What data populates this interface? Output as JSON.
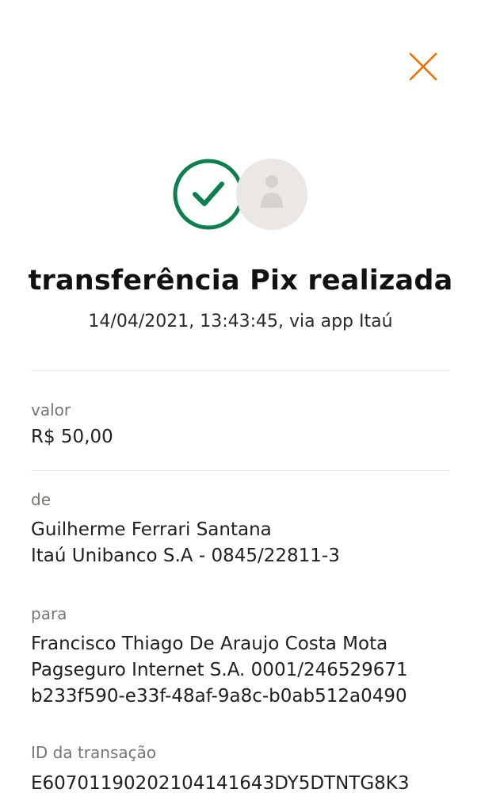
{
  "header": {
    "close_icon": "close-icon",
    "accent_color": "#ec7000"
  },
  "status": {
    "success_icon": "check-circle-icon",
    "success_color": "#0b7f4e",
    "avatar_icon": "person-avatar-icon",
    "title": "transferência Pix realizada",
    "subtitle": "14/04/2021, 13:43:45, via app Itaú"
  },
  "details": {
    "valor": {
      "label": "valor",
      "amount": "R$ 50,00"
    },
    "de": {
      "label": "de",
      "name": "Guilherme Ferrari Santana",
      "bank": "Itaú Unibanco S.A - 0845/22811-3"
    },
    "para": {
      "label": "para",
      "name": "Francisco Thiago De Araujo Costa Mota",
      "bank": "Pagseguro Internet S.A. 0001/246529671",
      "key": "b233f590-e33f-48af-9a8c-b0ab512a0490"
    },
    "transacao": {
      "label": "ID da transação",
      "id": "E60701190202104141643DY5DTNTG8K3"
    }
  }
}
